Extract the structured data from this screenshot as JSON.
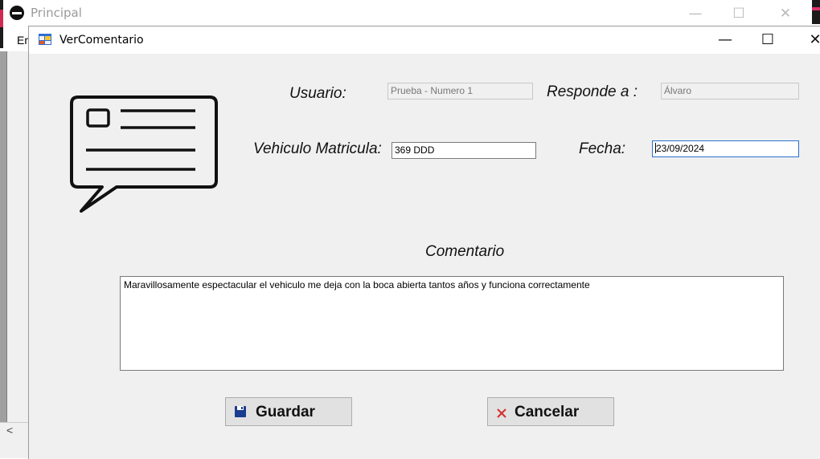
{
  "parent_window": {
    "title": "Principal",
    "minimize_glyph": "—",
    "maximize_glyph": "☐",
    "close_glyph": "✕",
    "menu_item_partial": "Er",
    "scroll_left_glyph": "<"
  },
  "dialog": {
    "title": "VerComentario",
    "minimize_glyph": "—",
    "maximize_glyph": "☐",
    "close_glyph": "✕"
  },
  "form": {
    "usuario_label": "Usuario:",
    "usuario_value": "Prueba - Numero 1",
    "responde_label": "Responde a :",
    "responde_value": "Álvaro",
    "matricula_label": "Vehiculo Matricula:",
    "matricula_value": "369 DDD",
    "fecha_label": "Fecha:",
    "fecha_value": "23/09/2024",
    "comentario_label": "Comentario",
    "comentario_value": "Maravillosamente espectacular el vehiculo me deja con la boca abierta tantos años y funciona correctamente"
  },
  "buttons": {
    "save_label": "Guardar",
    "cancel_label": "Cancelar",
    "save_icon": "floppy-disk-icon",
    "cancel_icon": "x-icon"
  },
  "colors": {
    "window_bg": "#f0f0f0",
    "focus_border": "#2a70d1",
    "cancel_icon": "#d32f2f",
    "save_icon": "#1a3d8f"
  }
}
